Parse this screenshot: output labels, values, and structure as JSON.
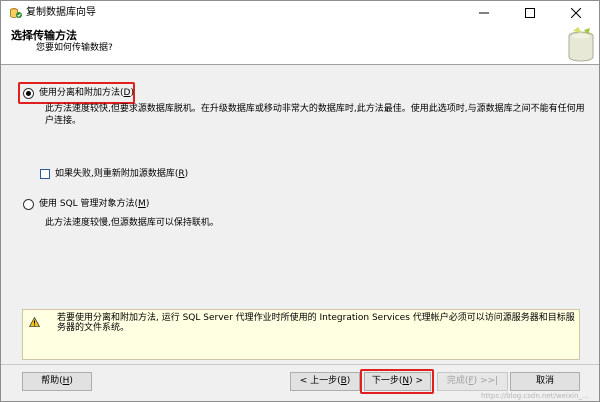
{
  "window": {
    "title": "复制数据库向导"
  },
  "header": {
    "title": "选择传输方法",
    "subtitle": "您要如何传输数据?"
  },
  "options": {
    "detach": {
      "label_prefix": "使用分离和附加方法(",
      "mnemonic": "D",
      "label_suffix": ")",
      "selected": true,
      "description": "此方法速度较快,但要求源数据库脱机。在升级数据库或移动非常大的数据库时,此方法最佳。使用此选项时,与源数据库之间不能有任何用户连接。"
    },
    "reattach": {
      "label_prefix": "如果失败,则重新附加源数据库(",
      "mnemonic": "R",
      "label_suffix": ")",
      "checked": false
    },
    "smo": {
      "label_prefix": "使用 SQL 管理对象方法(",
      "mnemonic": "M",
      "label_suffix": ")",
      "selected": false,
      "description": "此方法速度较慢,但源数据库可以保持联机。"
    }
  },
  "warning": {
    "icon": "warning-icon",
    "text": "若要使用分离和附加方法, 运行 SQL Server 代理作业时所使用的 Integration Services 代理帐户必须可以访问源服务器和目标服务器的文件系统。"
  },
  "buttons": {
    "help": {
      "prefix": "帮助(",
      "mnemonic": "H",
      "suffix": ")"
    },
    "back": {
      "prefix": "< 上一步(",
      "mnemonic": "B",
      "suffix": ")"
    },
    "next": {
      "prefix": "下一步(",
      "mnemonic": "N",
      "suffix": ") >"
    },
    "finish": {
      "prefix": "完成(",
      "mnemonic": "F",
      "suffix": ") >>|"
    },
    "cancel": {
      "label": "取消"
    }
  },
  "watermark": "https://blog.csdn.net/weixin_...",
  "colors": {
    "highlight": "#e0201f",
    "warning_bg": "#ffffe1"
  }
}
